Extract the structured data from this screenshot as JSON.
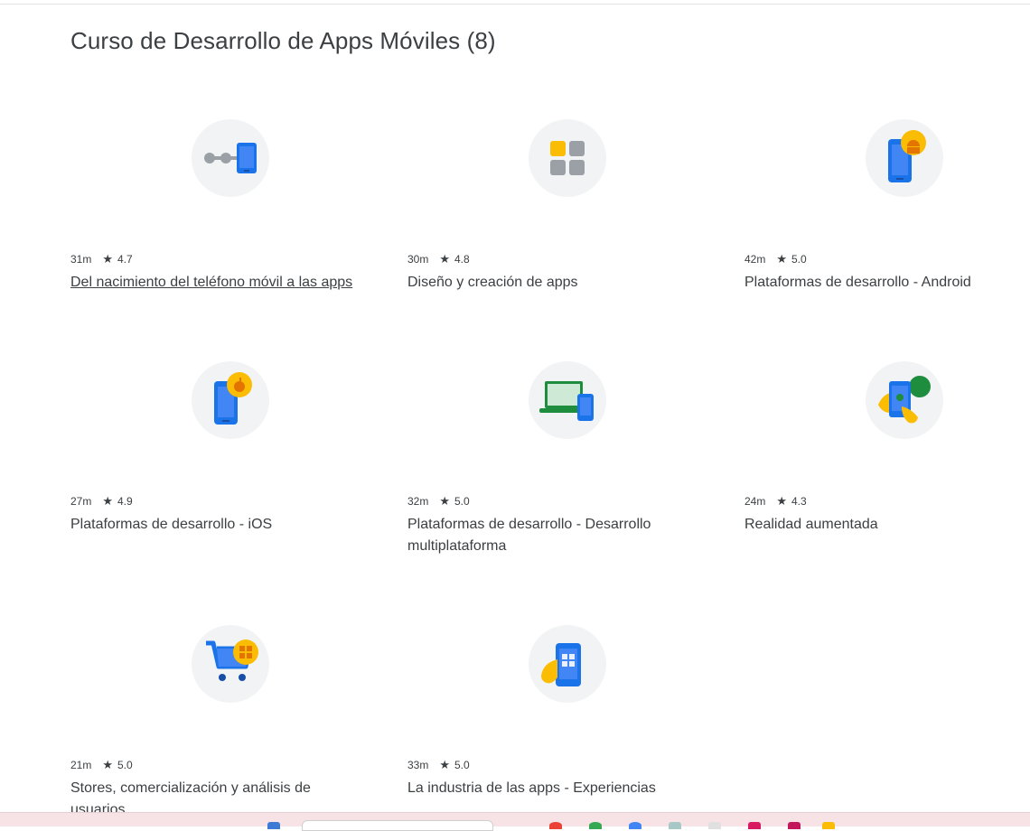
{
  "page": {
    "title": "Curso de Desarrollo de Apps Móviles (8)"
  },
  "courses": [
    {
      "duration": "31m",
      "star": "★",
      "rating": "4.7",
      "title": "Del nacimiento del teléfono móvil a las apps",
      "icon": "phone-connection-icon"
    },
    {
      "duration": "30m",
      "star": "★",
      "rating": "4.8",
      "title": "Diseño y creación de apps",
      "icon": "app-grid-icon"
    },
    {
      "duration": "42m",
      "star": "★",
      "rating": "5.0",
      "title": "Plataformas de desarrollo - Android",
      "icon": "android-phone-icon"
    },
    {
      "duration": "27m",
      "star": "★",
      "rating": "4.9",
      "title": "Plataformas de desarrollo - iOS",
      "icon": "ios-phone-icon"
    },
    {
      "duration": "32m",
      "star": "★",
      "rating": "5.0",
      "title": "Plataformas de desarrollo - Desarrollo multiplataforma",
      "icon": "laptop-phone-icon"
    },
    {
      "duration": "24m",
      "star": "★",
      "rating": "4.3",
      "title": "Realidad aumentada",
      "icon": "augmented-reality-icon"
    },
    {
      "duration": "21m",
      "star": "★",
      "rating": "5.0",
      "title": "Stores, comercialización y análisis de usuarios",
      "icon": "shopping-cart-icon"
    },
    {
      "duration": "33m",
      "star": "★",
      "rating": "5.0",
      "title": "La industria de las apps - Experiencias",
      "icon": "hand-phone-icon"
    }
  ],
  "colors": {
    "blue": "#1a73e8",
    "yellow": "#fbbc04",
    "green": "#1e8e3e",
    "grey": "#9aa0a6",
    "circle": "#f1f3f4"
  }
}
